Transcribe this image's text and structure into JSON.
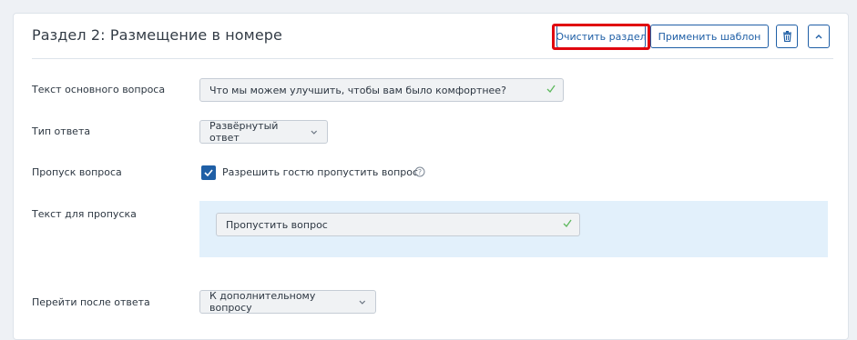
{
  "section": {
    "title": "Раздел 2: Размещение в номере",
    "clear_label": "Очистить раздел",
    "template_label": "Применить шаблон"
  },
  "fields": {
    "question_label": "Текст основного вопроса",
    "question_value": "Что мы можем улучшить, чтобы вам было комфортнее?",
    "answer_type_label": "Тип ответа",
    "answer_type_value": "Развёрнутый ответ",
    "skip_label": "Пропуск вопроса",
    "skip_checkbox_label": "Разрешить гостю пропустить вопрос",
    "skip_checked": true,
    "skip_text_label": "Текст для пропуска",
    "skip_text_value": "Пропустить вопрос",
    "next_label": "Перейти после ответа",
    "next_value": "К дополнительному вопросу"
  },
  "colors": {
    "accent": "#1f5fa6",
    "highlight": "#e0060e",
    "valid_check": "#5cb85c",
    "skip_panel_bg": "#e2f0fb"
  },
  "icons": [
    "trash-icon",
    "chevron-up-icon",
    "check-icon",
    "chevron-down-icon",
    "help-icon"
  ]
}
